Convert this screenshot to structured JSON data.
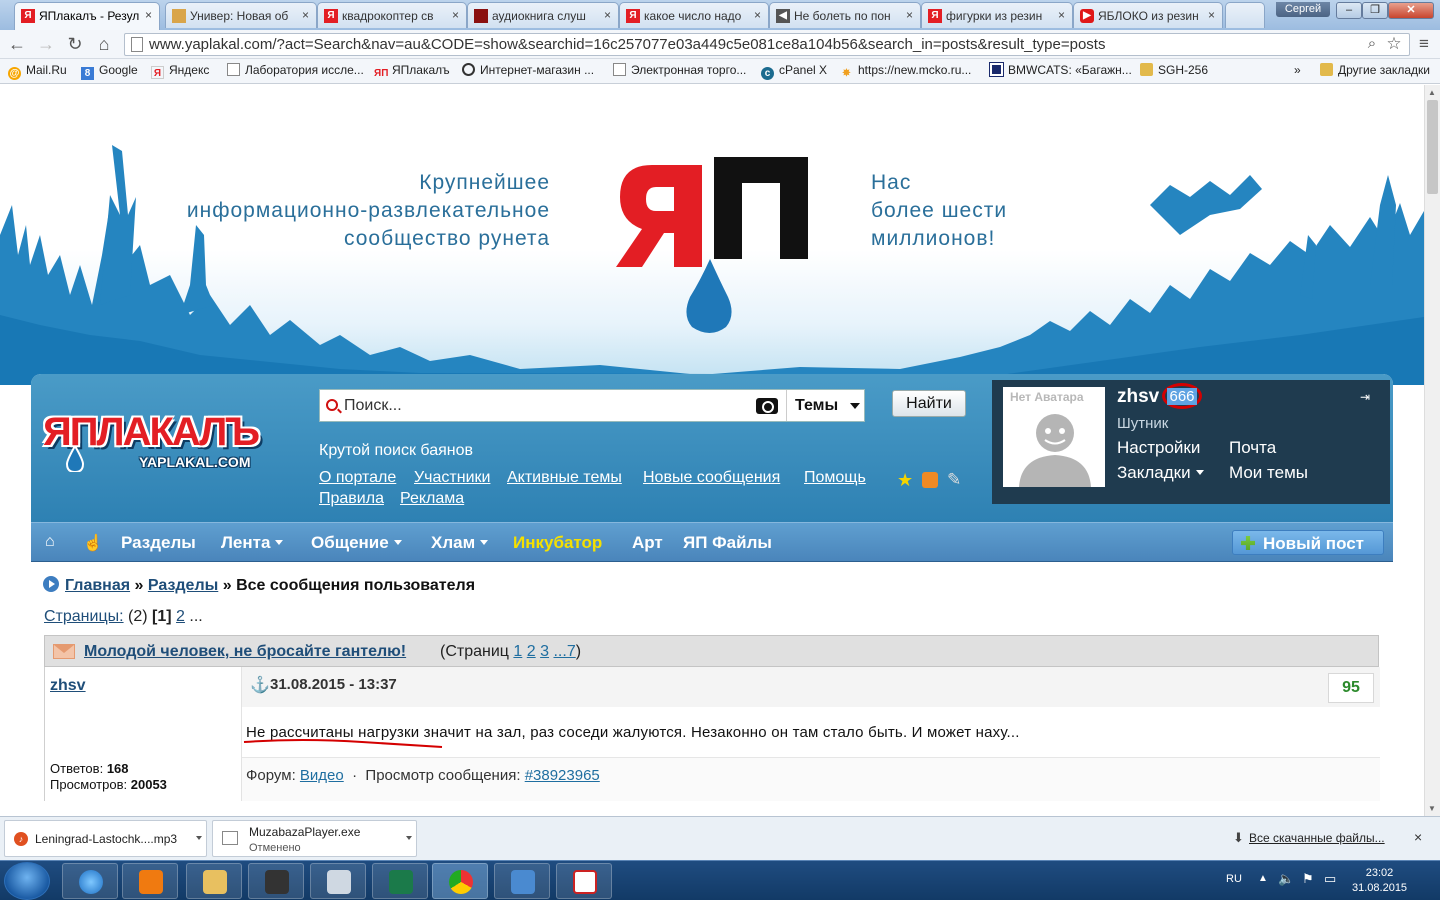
{
  "browser": {
    "tabs": [
      {
        "label": "ЯПлакалъ - Резул",
        "icon": "yap-favicon",
        "active": true
      },
      {
        "label": "Универ: Новая об",
        "icon": "doc-favicon"
      },
      {
        "label": "квадрокоптер св",
        "icon": "yandex-favicon"
      },
      {
        "label": "аудиокнига слуш",
        "icon": "book-favicon"
      },
      {
        "label": "какое число надо",
        "icon": "yandex-favicon"
      },
      {
        "label": "Не болеть по пон",
        "icon": "speaker-favicon"
      },
      {
        "label": "фигурки из резин",
        "icon": "yandex-favicon"
      },
      {
        "label": "ЯБЛОКО из резин",
        "icon": "youtube-favicon"
      }
    ],
    "tab_close": "×",
    "profile_name": "Сергей",
    "url": "www.yaplakal.com/?act=Search&nav=au&CODE=show&searchid=16c257077e03a449c5e081ce8a104b56&search_in=posts&result_type=posts",
    "bookmarks": [
      {
        "label": "Mail.Ru",
        "icon": "mailru-icon",
        "color": "#f7a600"
      },
      {
        "label": "Google",
        "icon": "google-icon",
        "color": "#3a7bd5"
      },
      {
        "label": "Яндекс",
        "icon": "yandex-icon",
        "color": "#e31e24"
      },
      {
        "label": "Лаборатория иссле...",
        "icon": "page-icon",
        "color": "#888888"
      },
      {
        "label": "ЯПлакалъ",
        "icon": "yap-icon",
        "color": "#e31e24"
      },
      {
        "label": "Интернет-магазин ...",
        "icon": "shop-icon",
        "color": "#333333"
      },
      {
        "label": "Электронная торго...",
        "icon": "page-icon",
        "color": "#888888"
      },
      {
        "label": "cPanel X",
        "icon": "cpanel-icon",
        "color": "#1b6b8f"
      },
      {
        "label": "https://new.mcko.ru...",
        "icon": "mcko-icon",
        "color": "#f0a020"
      },
      {
        "label": "BMWCATS: «Багажн...",
        "icon": "bmw-icon",
        "color": "#1a2a6c"
      },
      {
        "label": "SGH-256",
        "icon": "folder-icon",
        "color": "#e2b94b"
      }
    ],
    "bookmarks_more": "»",
    "other_bookmarks": "Другие закладки"
  },
  "banner": {
    "left_text": [
      "Крупнейшее",
      "информационно-развлекательное",
      "сообщество рунета"
    ],
    "right_text": [
      "Нас",
      "более шести",
      "миллионов!"
    ],
    "logo_letters": "ЯП"
  },
  "site": {
    "logo": "ЯПЛАКАЛЪ",
    "logo_sub": "YAPLAKAL.COM",
    "search_placeholder": "Поиск...",
    "search_scope": "Темы",
    "find_button": "Найти",
    "tagline": "Крутой поиск баянов",
    "header_links_row1": [
      "О портале",
      "Участники",
      "Активные темы",
      "Новые сообщения",
      "Помощь"
    ],
    "header_links_row2": [
      "Правила",
      "Реклама"
    ]
  },
  "user": {
    "avatar_text": "Нет Аватара",
    "name": "zhsv",
    "reputation": "666",
    "rank": "Шутник",
    "links": [
      "Настройки",
      "Почта",
      "Закладки",
      "Мои темы"
    ]
  },
  "nav": {
    "items": [
      {
        "label": "Разделы"
      },
      {
        "label": "Лента",
        "dropdown": true
      },
      {
        "label": "Общение",
        "dropdown": true
      },
      {
        "label": "Хлам",
        "dropdown": true
      },
      {
        "label": "Инкубатор",
        "highlight": true
      },
      {
        "label": "Арт"
      },
      {
        "label": "ЯП Файлы"
      }
    ],
    "new_post": "Новый пост"
  },
  "breadcrumb": {
    "home": "Главная",
    "sep": "»",
    "sections": "Разделы",
    "current": "Все сообщения пользователя"
  },
  "pagination": {
    "label": "Страницы:",
    "count": "(2)",
    "current": "[1]",
    "next": "2",
    "more": "..."
  },
  "topic": {
    "title": "Молодой человек, не бросайте гантелю!",
    "pages_prefix": "(Страниц",
    "pages": [
      "1",
      "2",
      "3",
      "...7"
    ],
    "pages_suffix": ")"
  },
  "post": {
    "author": "zhsv",
    "replies_label": "Ответов:",
    "replies": "168",
    "views_label": "Просмотров:",
    "views": "20053",
    "date": "31.08.2015 - 13:37",
    "score": "95",
    "text": "Не рассчитаны нагрузки значит на зал, раз соседи жалуются. Незаконно он там стало быть. И может наху...",
    "forum_label": "Форум:",
    "forum": "Видео",
    "dot": "·",
    "view_label": "Просмотр сообщения:",
    "post_id": "#38923965"
  },
  "downloads": {
    "items": [
      {
        "name": "Leningrad-Lastochk....mp3",
        "status": ""
      },
      {
        "name": "MuzabazaPlayer.exe",
        "status": "Отменено"
      }
    ],
    "all": "Все скачанные файлы...",
    "close": "×"
  },
  "taskbar": {
    "lang": "RU",
    "time": "23:02",
    "date": "31.08.2015"
  }
}
